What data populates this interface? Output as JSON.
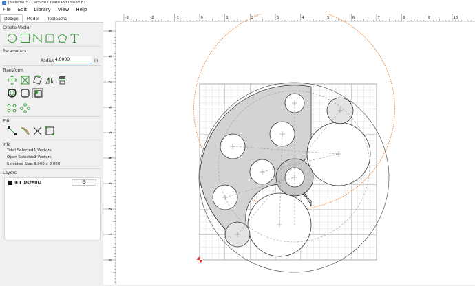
{
  "window": {
    "title": "[NewFile]* - Carbide Create PRO Build 821"
  },
  "menu": {
    "file": "File",
    "edit": "Edit",
    "view": "View",
    "help": "Help",
    "library": "Library"
  },
  "tabs": [
    "Design",
    "Model",
    "Toolpaths"
  ],
  "create_vector": {
    "heading": "Create Vector",
    "icons": [
      "circle-icon",
      "rectangle-icon",
      "polyline-icon",
      "rounded-rect-icon",
      "polygon-icon",
      "text-icon"
    ]
  },
  "parameters": {
    "heading": "Parameters",
    "radius_label": "Radius",
    "radius_value": "4.0000",
    "unit": "in"
  },
  "transform": {
    "heading": "Transform"
  },
  "edit": {
    "heading": "Edit"
  },
  "info": {
    "heading": "Info",
    "total_selected_label": "Total Selected:",
    "total_selected_value": "1 Vectors",
    "open_selected_label": "Open Selected:",
    "open_selected_value": "0 Vectors",
    "selected_size_label": "Selected Size:",
    "selected_size_value": "8.000 x 8.000"
  },
  "layers": {
    "heading": "Layers",
    "layer_name": "DEFAULT",
    "gear": "⚙"
  },
  "ruler": {
    "x_labels": [
      "-3",
      "-2",
      "-1",
      "0",
      "1",
      "2",
      "3",
      "4",
      "5",
      "6",
      "7",
      "8",
      "9",
      "10"
    ],
    "y_labels": [
      "9",
      "8",
      "7",
      "6",
      "5",
      "4",
      "3",
      "2",
      "1",
      "0"
    ]
  },
  "colors": {
    "accent": "#2d6bd6",
    "vector": "#3a9a3a",
    "selection": "#f07d2a",
    "fill": "#d4d4d4"
  }
}
